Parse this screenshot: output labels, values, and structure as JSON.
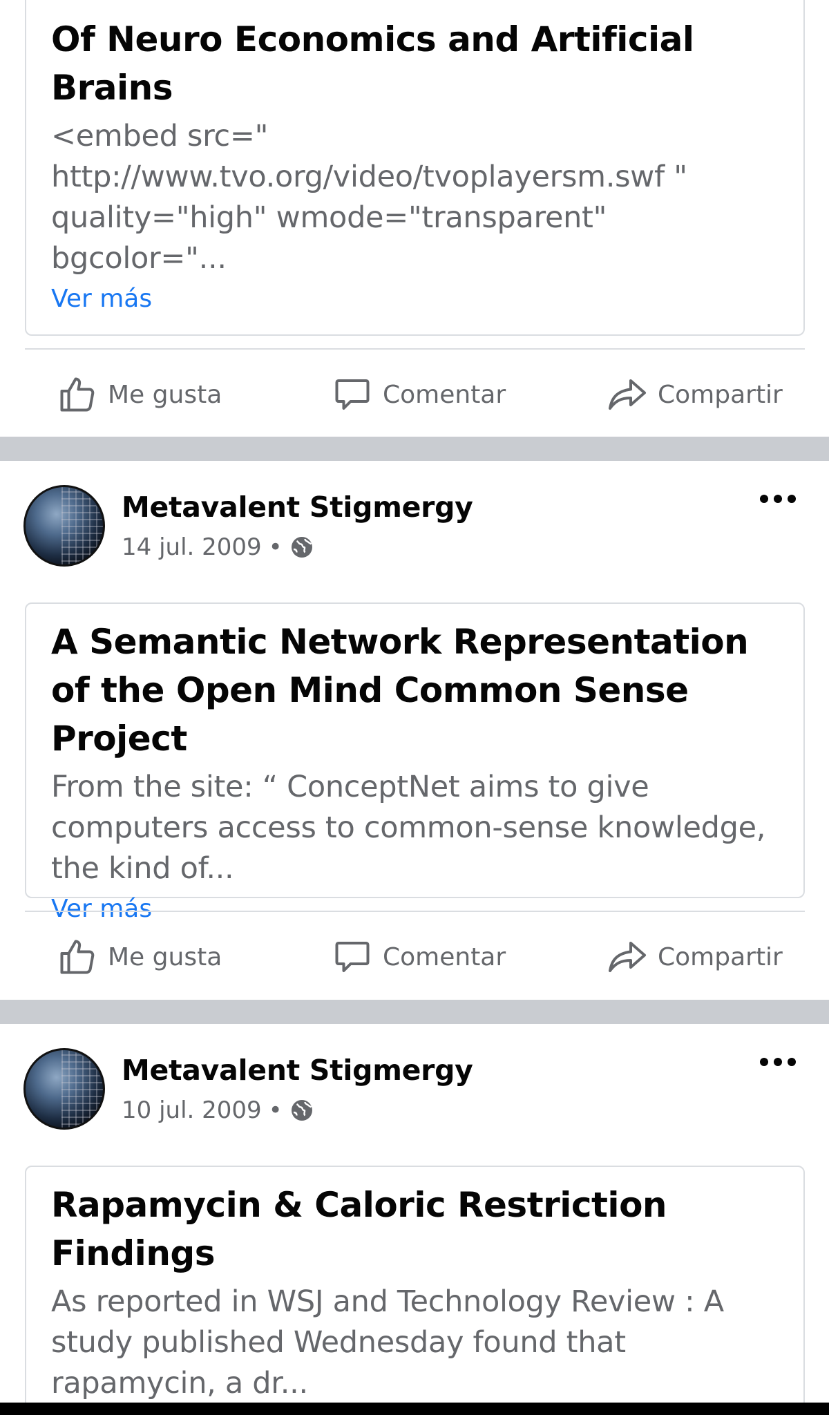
{
  "colors": {
    "link": "#1877f2",
    "muted": "#65676b",
    "divider": "#c9ccd1"
  },
  "actions": {
    "like": "Me gusta",
    "comment": "Comentar",
    "share": "Compartir"
  },
  "posts": [
    {
      "title": "Of Neuro Economics and Artificial Brains",
      "text": "<embed src=\" http://www.tvo.org/video/tvoplayersm.swf \" quality=\"high\" wmode=\"transparent\" bgcolor=\"...",
      "see_more": "Ver más"
    },
    {
      "author": "Metavalent Stigmergy",
      "date": "14 jul. 2009",
      "separator": "•",
      "privacy_icon": "globe-icon",
      "title": "A Semantic Network Representation of the Open Mind Common Sense Project",
      "text": "From the site: “ ConceptNet  aims to give computers access to common-sense knowledge, the kind of...",
      "see_more": "Ver más"
    },
    {
      "author": "Metavalent Stigmergy",
      "date": "10 jul. 2009",
      "separator": "•",
      "privacy_icon": "globe-icon",
      "title": "Rapamycin & Caloric Restriction Findings",
      "text": "As reported in  WSJ  and  Technology Review : A study published Wednesday found that rapamycin, a dr..."
    }
  ]
}
